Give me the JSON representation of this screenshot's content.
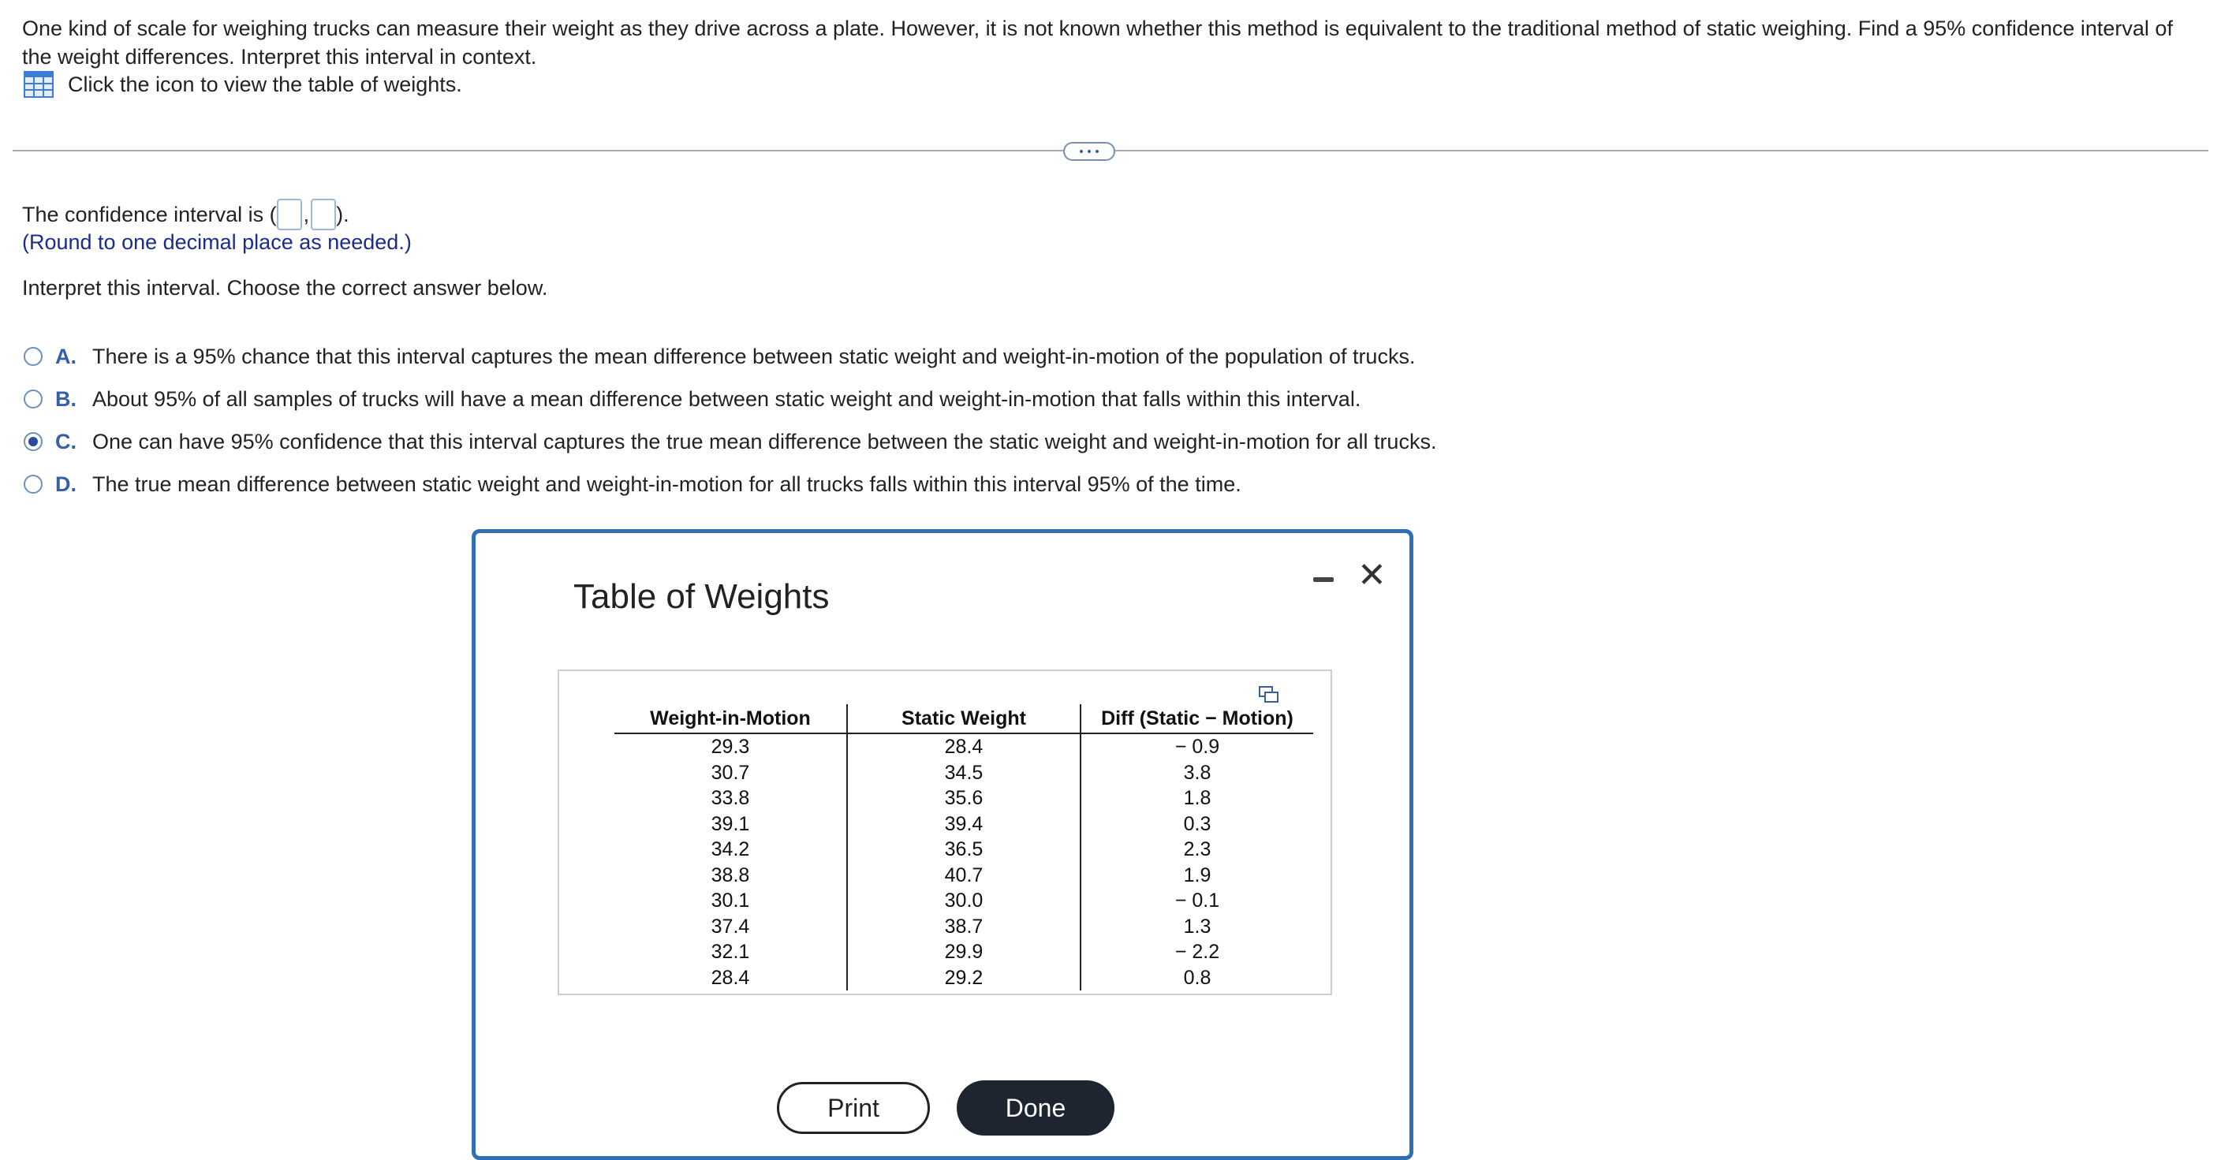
{
  "question": {
    "text": "One kind of scale for weighing trucks can measure their weight as they drive across a plate. However, it is not known whether this method is equivalent to the traditional method of static weighing. Find a 95% confidence interval of the weight differences. Interpret this interval in context.",
    "table_link_text": "Click the icon to view the table of weights."
  },
  "answer": {
    "ci_prefix": "The confidence interval is (",
    "ci_separator": ",",
    "ci_suffix": ").",
    "ci_lower_value": "",
    "ci_upper_value": "",
    "round_hint": "(Round to one decimal place as needed.)",
    "interpret_prompt": "Interpret this interval. Choose the correct answer below.",
    "selected_option": "C",
    "options": [
      {
        "letter": "A.",
        "text": "There is a 95% chance that this interval captures the mean difference between static weight and weight-in-motion of the population of trucks."
      },
      {
        "letter": "B.",
        "text": "About 95% of all samples of trucks will have a mean difference between static weight and weight-in-motion that falls within this interval."
      },
      {
        "letter": "C.",
        "text": "One can have 95% confidence that this interval captures the true mean difference between the static weight and weight-in-motion for all trucks."
      },
      {
        "letter": "D.",
        "text": "The true mean difference between static weight and weight-in-motion for all trucks falls within this interval 95% of the time."
      }
    ]
  },
  "modal": {
    "title": "Table of Weights",
    "columns": [
      "Weight-in-Motion",
      "Static Weight",
      "Diff (Static − Motion)"
    ],
    "rows": [
      [
        "29.3",
        "28.4",
        "− 0.9"
      ],
      [
        "30.7",
        "34.5",
        "3.8"
      ],
      [
        "33.8",
        "35.6",
        "1.8"
      ],
      [
        "39.1",
        "39.4",
        "0.3"
      ],
      [
        "34.2",
        "36.5",
        "2.3"
      ],
      [
        "38.8",
        "40.7",
        "1.9"
      ],
      [
        "30.1",
        "30.0",
        "− 0.1"
      ],
      [
        "37.4",
        "38.7",
        "1.3"
      ],
      [
        "32.1",
        "29.9",
        "− 2.2"
      ],
      [
        "28.4",
        "29.2",
        "0.8"
      ]
    ],
    "print_label": "Print",
    "done_label": "Done"
  },
  "colors": {
    "accent_blue": "#2f6fb3",
    "hint_blue": "#1b2c8e",
    "done_button_bg": "#1e2530"
  },
  "icons": [
    "table-grid-icon",
    "more-dots-icon",
    "minimize-icon",
    "close-icon",
    "copy-icon"
  ]
}
